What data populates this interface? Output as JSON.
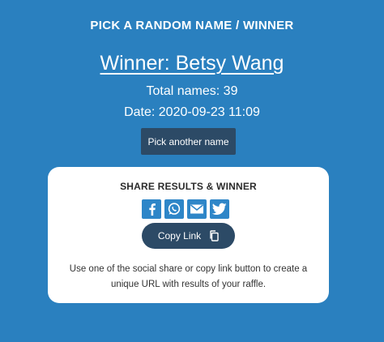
{
  "header": {
    "title": "PICK A RANDOM NAME / WINNER"
  },
  "result": {
    "winner": "Winner: Betsy Wang",
    "total_names": "Total names: 39",
    "date": "Date: 2020-09-23 11:09"
  },
  "actions": {
    "pick_another_label": "Pick another name"
  },
  "share": {
    "title": "SHARE RESULTS & WINNER",
    "icons": [
      "facebook-icon",
      "whatsapp-icon",
      "email-icon",
      "twitter-icon"
    ],
    "copy_link_label": "Copy Link",
    "description": "Use one of the social share or copy link button to create a unique URL with results of your raffle."
  },
  "colors": {
    "background": "#2a80bf",
    "button": "#2c4a66",
    "icon_bg": "#2e86c8",
    "card": "#ffffff"
  }
}
